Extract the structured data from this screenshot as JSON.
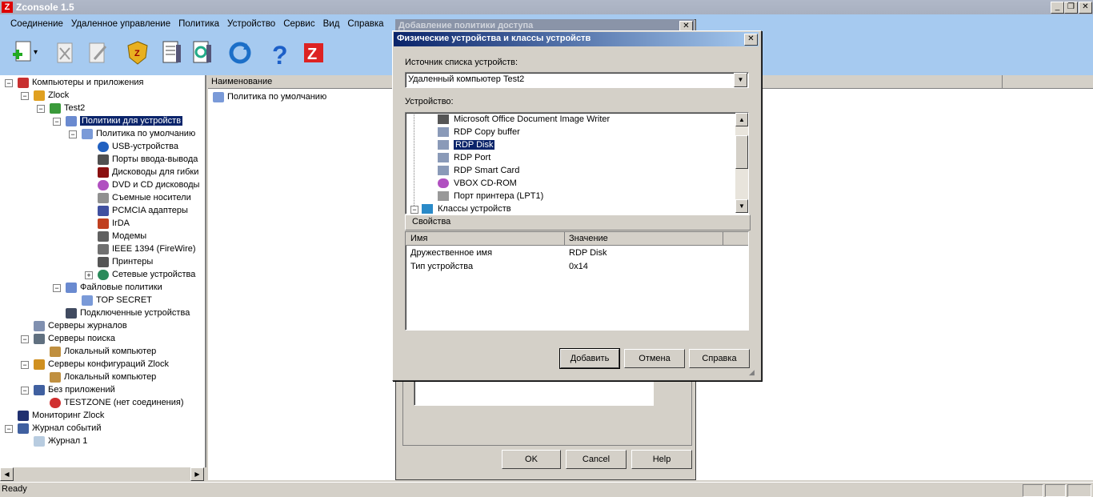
{
  "app": {
    "title": "Zconsole 1.5",
    "logo": "Z"
  },
  "menu": [
    "Соединение",
    "Удаленное управление",
    "Политика",
    "Устройство",
    "Сервис",
    "Вид",
    "Справка"
  ],
  "toolbar": [
    "new-icon",
    "delete-icon",
    "edit-icon",
    "zlock-shield-icon",
    "report-icon",
    "sync-config-icon",
    "refresh-icon",
    "help-icon",
    "zconsole-icon"
  ],
  "tree": {
    "root": "Компьютеры и приложения",
    "zlock": "Zlock",
    "test2": "Test2",
    "device_policies": "Политики для устройств",
    "default_policy": "Политика по умолчанию",
    "usb": "USB-устройства",
    "ports": "Порты ввода-вывода",
    "floppy": "Дисководы для гибки",
    "dvd": "DVD и CD дисководы",
    "removable": "Съемные носители",
    "pcmcia": "PCMCIA адаптеры",
    "irda": "IrDA",
    "modems": "Модемы",
    "ieee": "IEEE 1394 (FireWire)",
    "printers": "Принтеры",
    "network": "Сетевые устройства",
    "file_policies": "Файловые политики",
    "top_secret": "TOP SECRET",
    "connected": "Подключенные устройства",
    "log_servers": "Серверы журналов",
    "search_servers": "Серверы поиска",
    "local1": "Локальный компьютер",
    "config_servers": "Серверы конфигураций Zlock",
    "local2": "Локальный компьютер",
    "no_apps": "Без приложений",
    "testzone": "TESTZONE (нет соединения)",
    "monitoring": "Мониторинг Zlock",
    "event_log": "Журнал событий",
    "journal1": "Журнал 1"
  },
  "list": {
    "col_name": "Наименование",
    "row1": "Политика по умолчанию"
  },
  "status": {
    "text": "Ready"
  },
  "back_dialog": {
    "title": "Добавление политики доступа",
    "ok": "OK",
    "cancel": "Cancel",
    "help": "Help"
  },
  "dialog": {
    "title": "Физические устройства и классы устройств",
    "source_label": "Источник списка устройств:",
    "source_value": "Удаленный компьютер Test2",
    "device_label": "Устройство:",
    "devices": [
      "Microsoft Office Document Image Writer",
      "RDP Copy buffer",
      "RDP Disk",
      "RDP Port",
      "RDP Smart Card",
      "VBOX CD-ROM",
      "Порт принтера (LPT1)",
      "Классы устройств"
    ],
    "properties_tab": "Свойства",
    "col_name": "Имя",
    "col_value": "Значение",
    "props": [
      {
        "name": "Дружественное имя",
        "value": "RDP Disk"
      },
      {
        "name": "Тип устройства",
        "value": "0x14"
      }
    ],
    "add": "Добавить",
    "cancel": "Отмена",
    "help": "Справка",
    "close": "✕"
  }
}
